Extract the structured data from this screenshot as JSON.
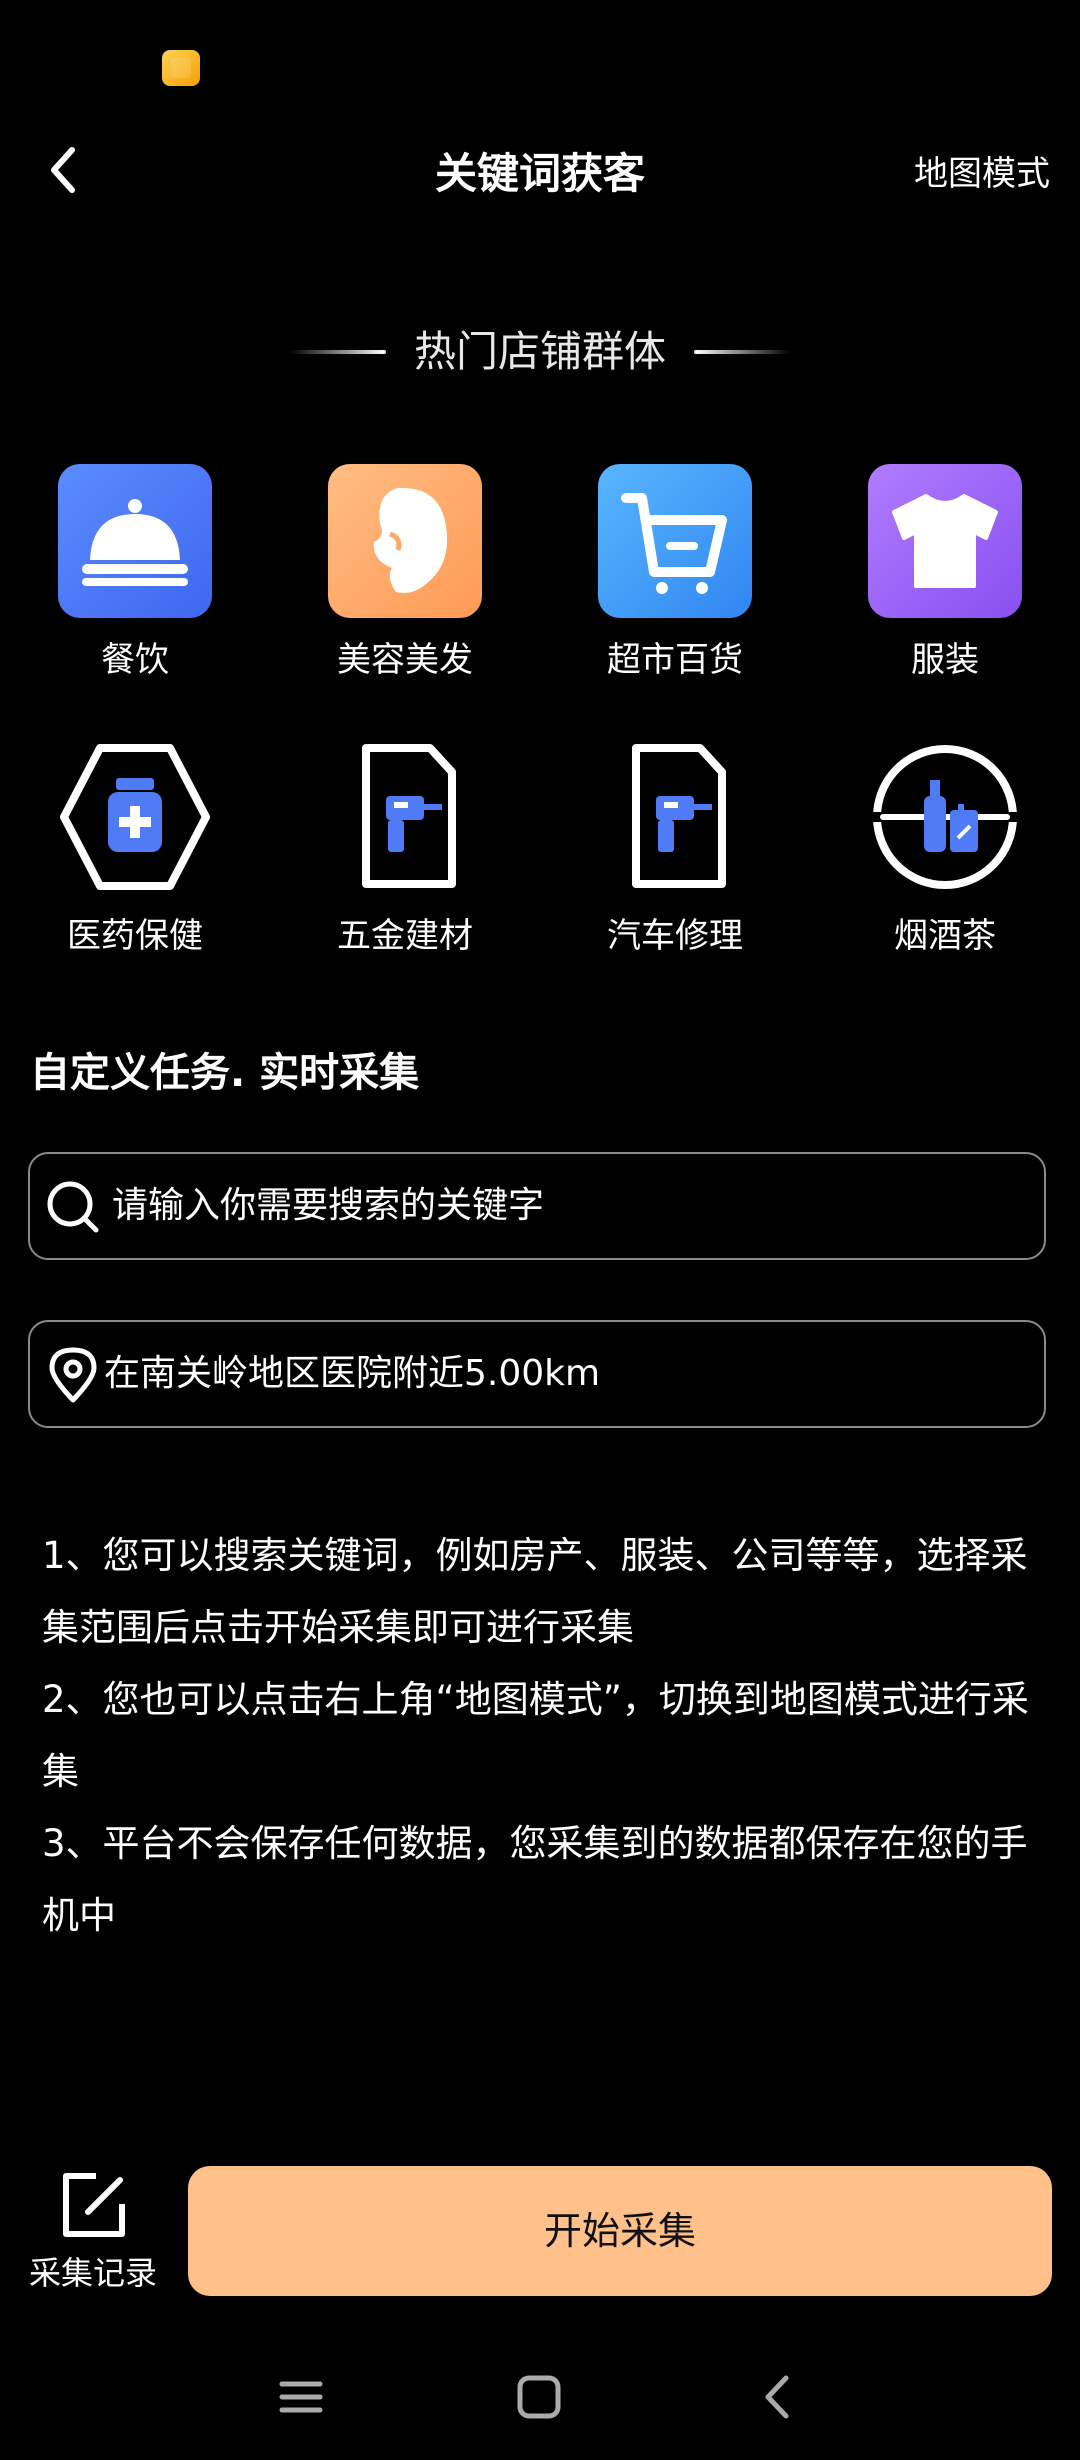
{
  "header": {
    "title": "关键词获客",
    "map_mode": "地图模式"
  },
  "hot": {
    "title": "热门店铺群体",
    "categories": [
      {
        "label": "餐饮",
        "icon": "dining-cloche-icon",
        "color": "#4f7cf6"
      },
      {
        "label": "美容美发",
        "icon": "beauty-head-icon",
        "color": "#ffa867"
      },
      {
        "label": "超市百货",
        "icon": "shopping-cart-icon",
        "color": "#3e9bf7"
      },
      {
        "label": "服装",
        "icon": "tshirt-icon",
        "color": "#9b5cf1"
      },
      {
        "label": "医药保健",
        "icon": "medicine-bottle-icon"
      },
      {
        "label": "五金建材",
        "icon": "drill-document-icon"
      },
      {
        "label": "汽车修理",
        "icon": "drill-document-icon"
      },
      {
        "label": "烟酒茶",
        "icon": "bottles-circle-icon"
      }
    ]
  },
  "custom": {
    "title": "自定义任务. 实时采集",
    "search_placeholder": "请输入你需要搜索的关键字",
    "location_text": "在南关岭地区医院附近5.00km"
  },
  "tips": [
    "1、您可以搜索关键词，例如房产、服装、公司等等，选择采集范围后点击开始采集即可进行采集",
    " 2、您也可以点击右上角“地图模式”，切换到地图模式进行采集",
    "3、平台不会保存任何数据，您采集到的数据都保存在您的手机中"
  ],
  "bottom": {
    "record_label": "采集记录",
    "start_label": "开始采集"
  },
  "accent_color": "#ffc08a"
}
